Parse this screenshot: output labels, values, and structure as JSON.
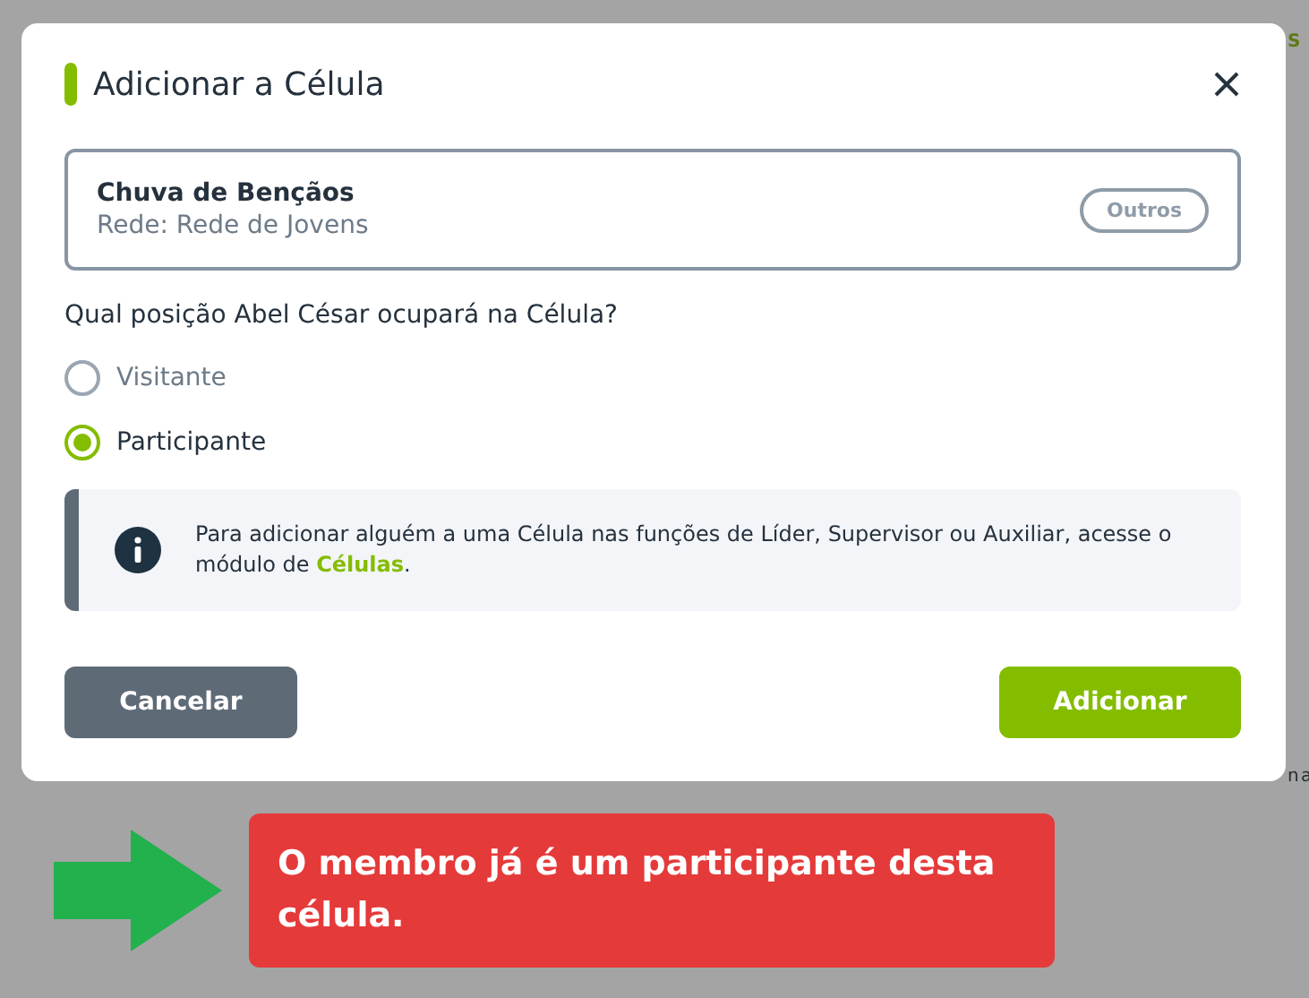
{
  "background": {
    "texts": [
      {
        "kind": "link",
        "text": "S"
      },
      {
        "kind": "plain",
        "text": "n a"
      }
    ]
  },
  "dialog": {
    "title": "Adicionar a Célula",
    "group": {
      "name": "Chuva de Bençãos",
      "network": "Rede: Rede de Jovens",
      "tag": "Outros"
    },
    "question": "Qual posição Abel César ocupará na Célula?",
    "options": [
      {
        "label": "Visitante",
        "selected": false
      },
      {
        "label": "Participante",
        "selected": true
      }
    ],
    "notice": {
      "text": "Para adicionar alguém a uma Célula nas funções de Líder, Supervisor ou Auxiliar, acesse o módulo de ",
      "link": "Células",
      "end": "."
    },
    "buttons": [
      {
        "kind": "secondary",
        "label": "Cancelar"
      },
      {
        "kind": "primary",
        "label": "Adicionar"
      }
    ]
  },
  "toast": {
    "text": "O membro já é um participante desta célula."
  }
}
